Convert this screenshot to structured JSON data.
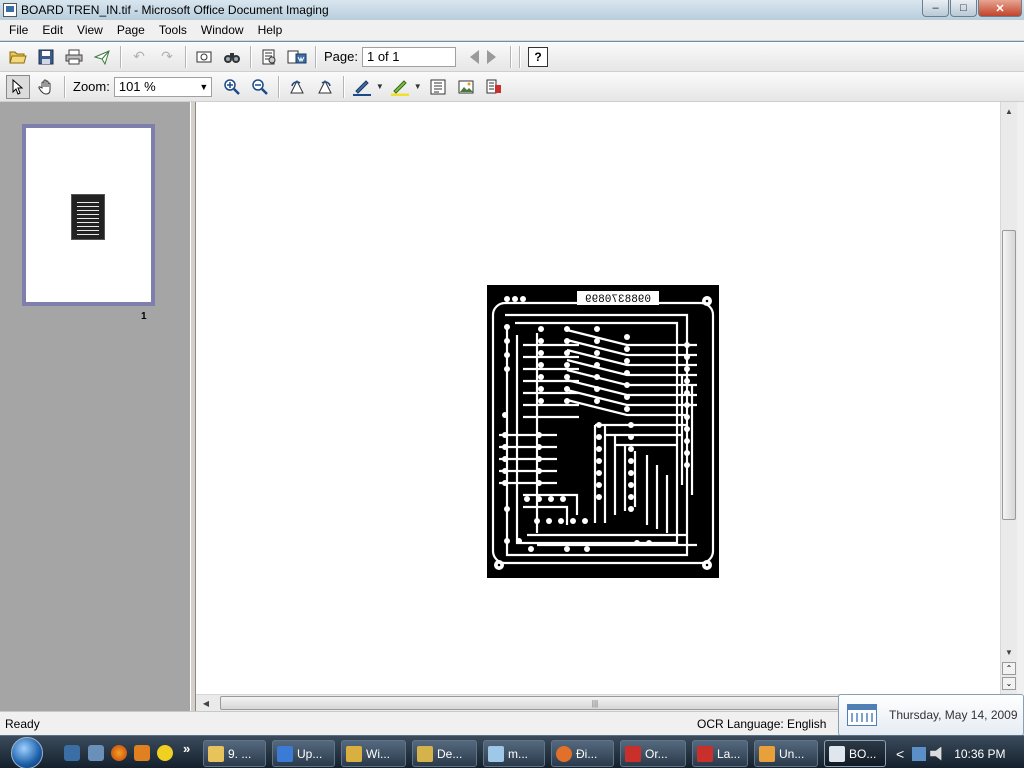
{
  "window": {
    "title": "BOARD TREN_IN.tif - Microsoft Office Document Imaging",
    "minimize": "–",
    "maximize": "□",
    "close": "✕"
  },
  "menu": [
    "File",
    "Edit",
    "View",
    "Page",
    "Tools",
    "Window",
    "Help"
  ],
  "toolbar1": {
    "page_label": "Page:",
    "page_value": "1 of 1",
    "help": "?",
    "icons": [
      "open-icon",
      "save-icon",
      "print-icon",
      "send-icon",
      "undo-icon",
      "redo-icon",
      "scan-icon",
      "find-icon",
      "ocr-icon",
      "send-to-word-icon",
      "prev-page-icon",
      "next-page-icon",
      "help-icon"
    ]
  },
  "toolbar2": {
    "zoom_label": "Zoom:",
    "zoom_value": "101 %",
    "icons": [
      "select-icon",
      "pan-icon",
      "zoom-in-icon",
      "zoom-out-icon",
      "rotate-left-icon",
      "rotate-right-icon",
      "pen-icon",
      "highlighter-icon",
      "text-box-icon",
      "picture-icon",
      "reading-view-icon"
    ]
  },
  "thumbnails": [
    {
      "page_number": "1"
    }
  ],
  "document": {
    "pcb_label": "0988370899"
  },
  "status": {
    "ready": "Ready",
    "ocr_language": "OCR Language: English"
  },
  "date_tooltip": "Thursday, May 14, 2009",
  "taskbar": {
    "buttons": [
      {
        "label": "9. ...",
        "color": "#e8c25a"
      },
      {
        "label": "Up...",
        "color": "#3a7bd5"
      },
      {
        "label": "Wi...",
        "color": "#d9b040"
      },
      {
        "label": "De...",
        "color": "#d6b24a"
      },
      {
        "label": "m...",
        "color": "#9fc7e8"
      },
      {
        "label": "Đi...",
        "color": "#e0702a"
      },
      {
        "label": "Or...",
        "color": "#c9302c"
      },
      {
        "label": "La...",
        "color": "#c9302c"
      },
      {
        "label": "Un...",
        "color": "#e8a13a"
      },
      {
        "label": "BO...",
        "color": "#dfe6ee"
      }
    ],
    "clock": "10:36 PM",
    "tray_chevron": "<"
  },
  "colors": {
    "thumbnail_pane": "#a5a5a5",
    "selection_border": "#7f7fae",
    "pcb_board": "#000000"
  }
}
